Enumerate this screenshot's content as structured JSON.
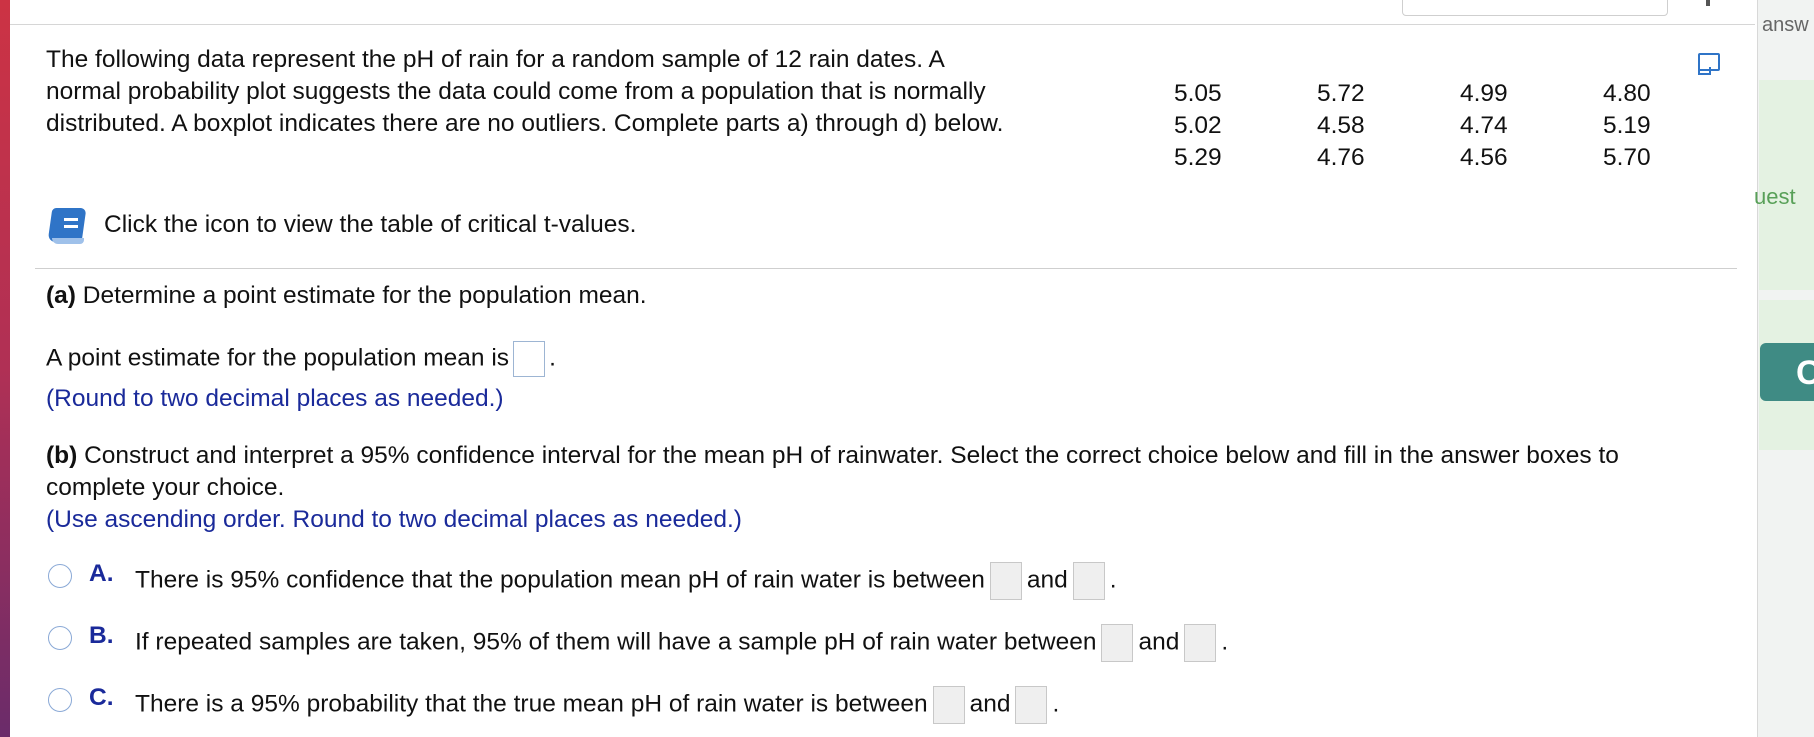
{
  "intro": {
    "line1": "The following data represent the pH of rain for a random sample of 12 rain dates. A",
    "line2": "normal probability plot suggests the data could come from a population that is normally",
    "line3": "distributed. A boxplot indicates there are no outliers. Complete parts a) through d) below."
  },
  "data_table": {
    "rows": [
      [
        "5.05",
        "5.72",
        "4.99",
        "4.80"
      ],
      [
        "5.02",
        "4.58",
        "4.74",
        "5.19"
      ],
      [
        "5.29",
        "4.76",
        "4.56",
        "5.70"
      ]
    ]
  },
  "table_link": "Click the icon to view the table of critical t-values.",
  "part_a": {
    "label": "(a)",
    "question": " Determine a point estimate for the population mean.",
    "answer_prefix": "A point estimate for the population mean is",
    "answer_suffix": ".",
    "hint": "(Round to two decimal places as needed.)"
  },
  "part_b": {
    "label": "(b)",
    "question_line1": " Construct and interpret a 95% confidence interval for the mean pH of rainwater. Select the correct choice below and fill in the answer boxes to",
    "question_line2": "complete your choice.",
    "hint": "(Use ascending order. Round to two decimal places as needed.)",
    "options": [
      {
        "letter": "A.",
        "text": "There is 95% confidence that the population mean pH of rain water is between",
        "and": "and",
        "end": "."
      },
      {
        "letter": "B.",
        "text": "If repeated samples are taken, 95% of them will have a sample pH of rain water between",
        "and": "and",
        "end": "."
      },
      {
        "letter": "C.",
        "text": "There is a 95% probability that the true mean pH of rain water is between",
        "and": "and",
        "end": "."
      }
    ]
  },
  "right_panel": {
    "top_text": "answ",
    "mid_text": "uest",
    "button_text": "C"
  },
  "colors": {
    "hint_blue": "#1a2a9a",
    "icon_blue": "#2f74c7",
    "panel_button": "#3f8b84"
  }
}
